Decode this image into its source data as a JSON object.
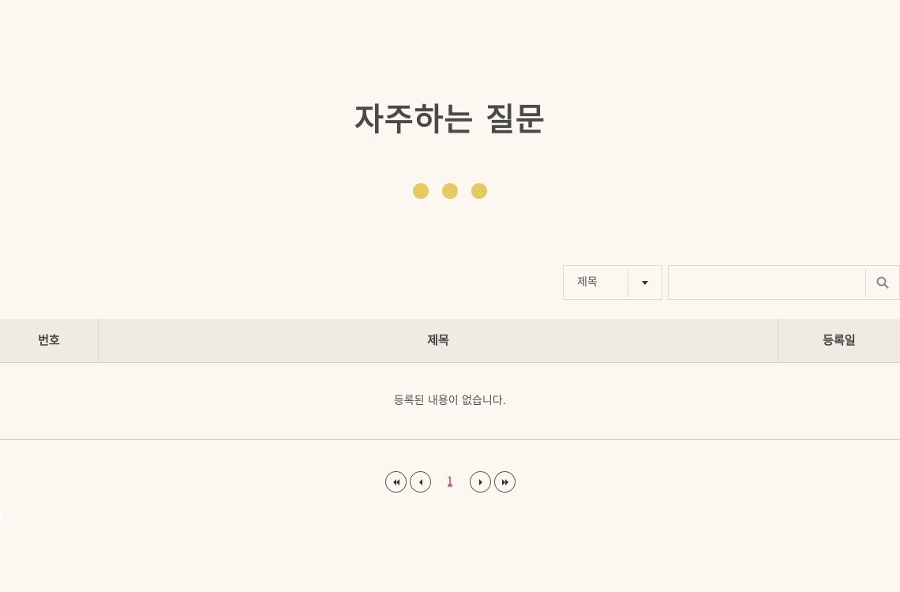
{
  "page": {
    "title": "자주하는 질문"
  },
  "decoration": {
    "dot_color": "#e7c962",
    "dots": 3
  },
  "search": {
    "select_value": "제목",
    "select_arrow_icon": "caret-down-icon",
    "input_value": "",
    "button_icon": "search-icon",
    "icon_color": "#888888"
  },
  "table": {
    "headers": {
      "number": "번호",
      "title": "제목",
      "date": "등록일"
    },
    "rows": [],
    "empty_message": "등록된 내용이 없습니다."
  },
  "pagination": {
    "current_page": "1",
    "current_color": "#c0336a",
    "buttons": [
      "first-page-icon",
      "prev-page-icon",
      "next-page-icon",
      "last-page-icon"
    ]
  }
}
